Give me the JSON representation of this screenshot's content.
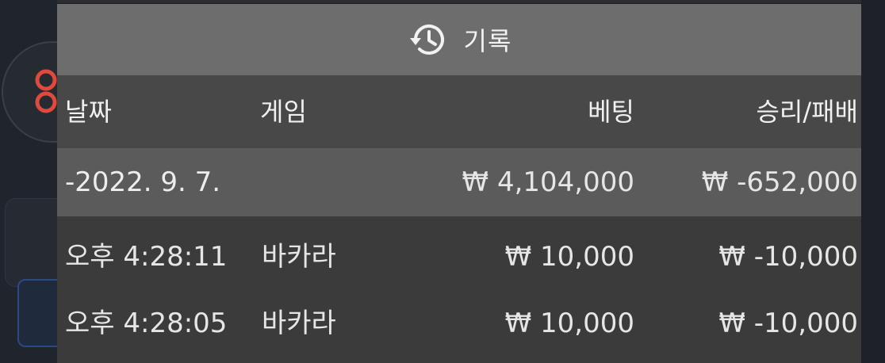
{
  "header": {
    "title": "기록",
    "icon": "history-icon"
  },
  "table": {
    "columns": {
      "date": "날짜",
      "game": "게임",
      "bet": "베팅",
      "result": "승리/패배"
    },
    "day_group": {
      "date": "-2022. 9. 7.",
      "total_bet": "₩ 4,104,000",
      "total_result": "₩ -652,000"
    },
    "rows": [
      {
        "time": "오후 4:28:11",
        "game": "바카라",
        "bet": "₩ 10,000",
        "result": "₩ -10,000"
      },
      {
        "time": "오후 4:28:05",
        "game": "바카라",
        "bet": "₩ 10,000",
        "result": "₩ -10,000"
      }
    ]
  },
  "colors": {
    "header_bg": "#6d6d6d",
    "column_header_bg": "#484848",
    "day_row_bg": "#5b5b5b",
    "rows_bg": "#3b3b3b",
    "logo_red": "#e04a3c"
  }
}
